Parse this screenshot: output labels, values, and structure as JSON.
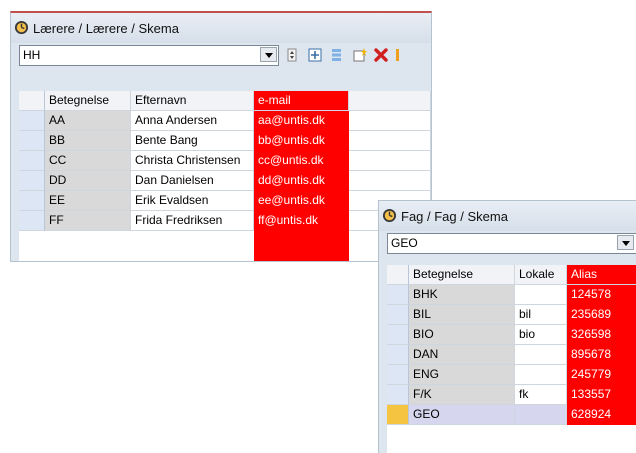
{
  "teachers_window": {
    "title": "Lærere / Lærere / Skema",
    "selector_value": "HH",
    "columns": [
      "Betegnelse",
      "Efternavn",
      "e-mail"
    ],
    "rows": [
      {
        "code": "AA",
        "name": "Anna Andersen",
        "email": "aa@untis.dk"
      },
      {
        "code": "BB",
        "name": "Bente Bang",
        "email": "bb@untis.dk"
      },
      {
        "code": "CC",
        "name": "Christa Christensen",
        "email": "cc@untis.dk"
      },
      {
        "code": "DD",
        "name": "Dan Danielsen",
        "email": "dd@untis.dk"
      },
      {
        "code": "EE",
        "name": "Erik Evaldsen",
        "email": "ee@untis.dk"
      },
      {
        "code": "FF",
        "name": "Frida Fredriksen",
        "email": "ff@untis.dk"
      }
    ]
  },
  "subjects_window": {
    "title": "Fag / Fag / Skema",
    "selector_value": "GEO",
    "columns": [
      "Betegnelse",
      "Lokale",
      "Alias"
    ],
    "rows": [
      {
        "code": "BHK",
        "room": "",
        "alias": "124578"
      },
      {
        "code": "BIL",
        "room": "bil",
        "alias": "235689"
      },
      {
        "code": "BIO",
        "room": "bio",
        "alias": "326598"
      },
      {
        "code": "DAN",
        "room": "",
        "alias": "895678"
      },
      {
        "code": "ENG",
        "room": "",
        "alias": "245779"
      },
      {
        "code": "F/K",
        "room": "fk",
        "alias": "133557"
      },
      {
        "code": "GEO",
        "room": "",
        "alias": "628924"
      }
    ]
  },
  "icons": [
    "clock-icon",
    "spin-icon",
    "move-icon",
    "list-icon",
    "new-icon",
    "delete-icon"
  ],
  "colors": {
    "highlight_column": "#ff0000",
    "selected_row": "#d6d6ee"
  }
}
